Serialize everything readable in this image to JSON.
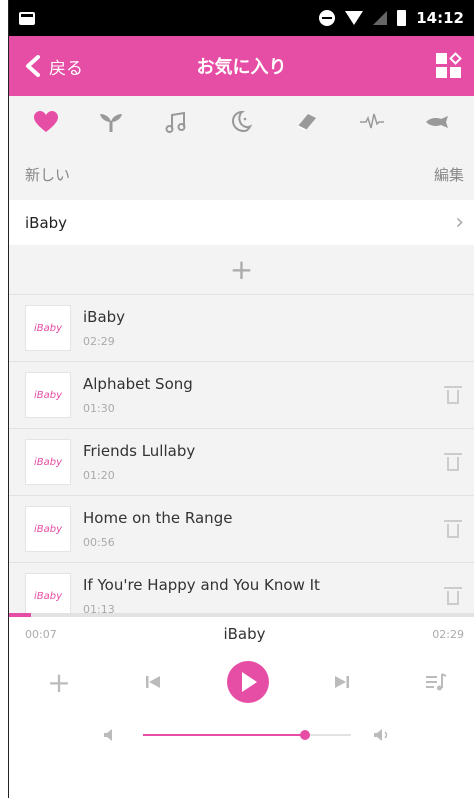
{
  "status_bar": {
    "time": "14:12"
  },
  "header": {
    "back_label": "戻る",
    "title": "お気に入り"
  },
  "categories": [
    {
      "icon": "heart-icon",
      "active": true
    },
    {
      "icon": "sprout-icon",
      "active": false
    },
    {
      "icon": "music-note-icon",
      "active": false
    },
    {
      "icon": "moon-icon",
      "active": false
    },
    {
      "icon": "book-icon",
      "active": false
    },
    {
      "icon": "heartbeat-icon",
      "active": false
    },
    {
      "icon": "fish-icon",
      "active": false
    }
  ],
  "section": {
    "new_label": "新しい",
    "edit_label": "編集"
  },
  "playlist": {
    "name": "iBaby"
  },
  "add_symbol": "+",
  "tracks": [
    {
      "title": "iBaby",
      "duration": "02:29",
      "thumb": "iBaby"
    },
    {
      "title": "Alphabet Song",
      "duration": "01:30",
      "thumb": "iBaby"
    },
    {
      "title": "Friends Lullaby",
      "duration": "01:20",
      "thumb": "iBaby"
    },
    {
      "title": "Home on the Range",
      "duration": "00:56",
      "thumb": "iBaby"
    },
    {
      "title": "If You're Happy and You Know It",
      "duration": "01:13",
      "thumb": "iBaby"
    }
  ],
  "player": {
    "elapsed": "00:07",
    "total": "02:29",
    "title": "iBaby",
    "progress_fraction": 0.047,
    "volume_fraction": 0.78,
    "add_symbol": "+"
  },
  "colors": {
    "accent": "#e64ea5",
    "header": "#e64ea5",
    "panel": "#f3f3f3"
  }
}
